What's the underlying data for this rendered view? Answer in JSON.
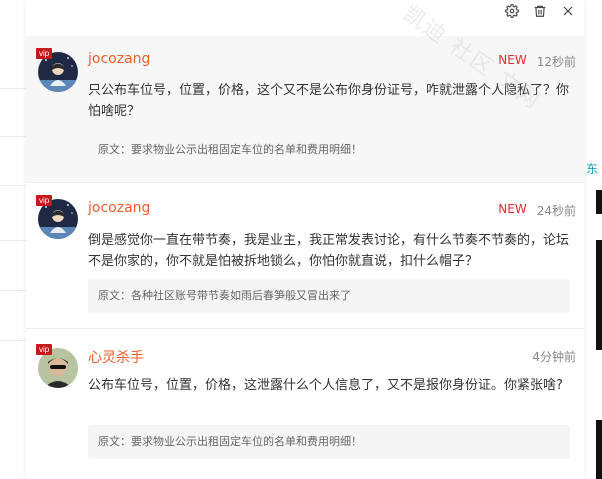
{
  "background": {
    "right_text": "东"
  },
  "toolbar": {
    "settings_icon": "gear-icon",
    "delete_icon": "trash-icon",
    "close_icon": "close-icon"
  },
  "watermark": {
    "text": "凯迪 社区 文网"
  },
  "colors": {
    "username": "#e8612c",
    "new_badge": "#e12c2c",
    "vip_badge": "#c9181a",
    "highlight_bg": "#f7f7f7"
  },
  "notifications": [
    {
      "vip_label": "vip",
      "username": "jocozang",
      "new_label": "NEW",
      "time": "12秒前",
      "content": "只公布车位号，位置，价格，这个又不是公布你身份证号，咋就泄露个人隐私了？你怕啥呢？",
      "original_label": "原文：要求物业公示出租固定车位的名单和费用明细！"
    },
    {
      "vip_label": "vip",
      "username": "jocozang",
      "new_label": "NEW",
      "time": "24秒前",
      "content": "倒是感觉你一直在带节奏，我是业主，我正常发表讨论，有什么节奏不节奏的，论坛不是你家的，你不就是怕被拆地锁么，你怕你就直说，扣什么帽子？",
      "original_label": "原文：各种社区账号带节奏如雨后春笋般又冒出来了"
    },
    {
      "vip_label": "vip",
      "username": "心灵杀手",
      "new_label": "",
      "time": "4分钟前",
      "content": "公布车位号，位置，价格，这泄露什么个人信息了，又不是报你身份证。你紧张啥?",
      "original_label": "原文：要求物业公示出租固定车位的名单和费用明细！"
    }
  ]
}
